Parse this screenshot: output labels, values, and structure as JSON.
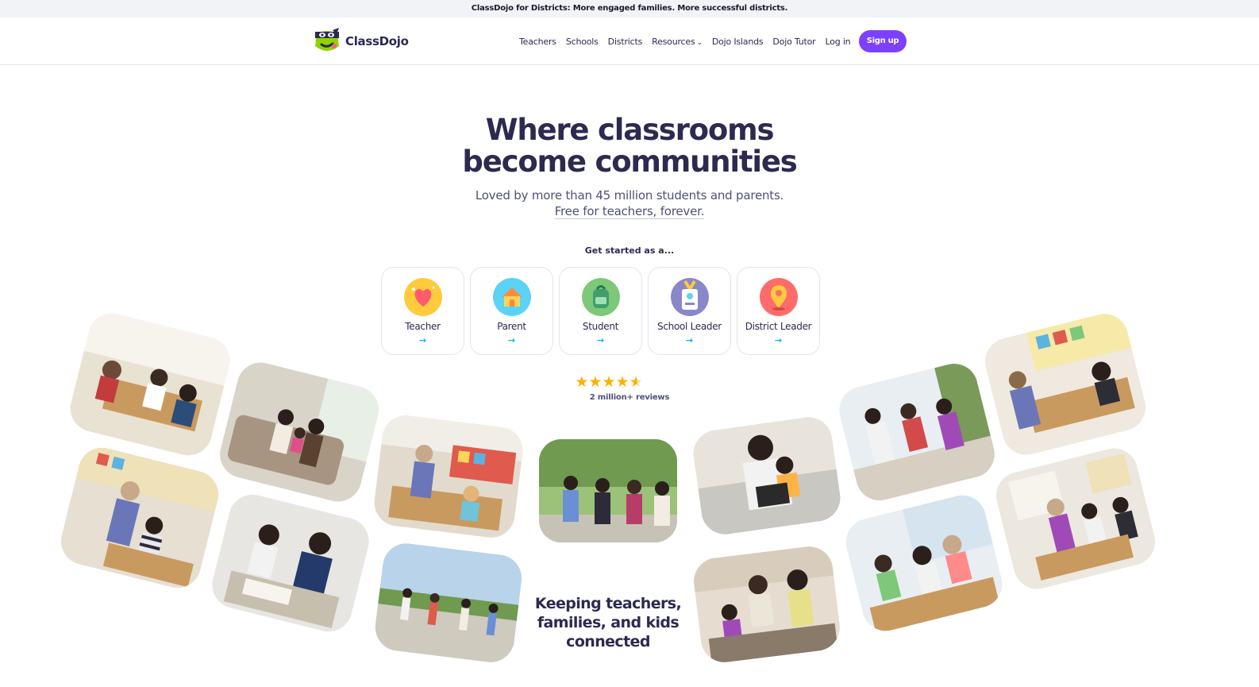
{
  "banner": {
    "text": "ClassDojo for Districts: More engaged families. More successful districts."
  },
  "brand": {
    "name": "ClassDojo",
    "logo_icon": "dojo-monster-icon",
    "colors": {
      "accent": "#7d40ff",
      "text": "#2c2a50",
      "link_arrow": "#00b2f7",
      "star": "#ffb000"
    }
  },
  "nav": {
    "items": [
      {
        "label": "Teachers"
      },
      {
        "label": "Schools"
      },
      {
        "label": "Districts"
      },
      {
        "label": "Resources",
        "icon": "chevron-down-icon"
      },
      {
        "label": "Dojo Islands"
      },
      {
        "label": "Dojo Tutor"
      }
    ],
    "login": "Log in",
    "signup": "Sign up"
  },
  "hero": {
    "title_line1": "Where classrooms",
    "title_line2": "become communities",
    "subtitle_line1": "Loved by more than 45 million students and parents.",
    "subtitle_line2": "Free for teachers, forever."
  },
  "get_started": {
    "heading": "Get started as a...",
    "roles": [
      {
        "label": "Teacher",
        "icon": "heart-icon",
        "arrow": "→"
      },
      {
        "label": "Parent",
        "icon": "house-icon",
        "arrow": "→"
      },
      {
        "label": "Student",
        "icon": "backpack-icon",
        "arrow": "→"
      },
      {
        "label": "School Leader",
        "icon": "id-badge-icon",
        "arrow": "→"
      },
      {
        "label": "District Leader",
        "icon": "map-pin-icon",
        "arrow": "→"
      }
    ]
  },
  "rating": {
    "stars": 4.5,
    "max_stars": 5,
    "reviews": "2 million+ reviews"
  },
  "photos": [
    {
      "name": "classroom-photo-group-table"
    },
    {
      "name": "family-photo-couch"
    },
    {
      "name": "classroom-photo-teacher-helping"
    },
    {
      "name": "students-photo-walking-school"
    },
    {
      "name": "parent-photo-tablet"
    },
    {
      "name": "classroom-photo-kids-playing"
    },
    {
      "name": "classroom-photo-art-table"
    },
    {
      "name": "classroom-photo-teacher-student"
    },
    {
      "name": "students-photo-reading"
    },
    {
      "name": "students-photo-field"
    },
    {
      "name": "family-photo-kitchen"
    },
    {
      "name": "classroom-photo-kids-laughing"
    },
    {
      "name": "classroom-photo-teacher-board"
    }
  ],
  "tagline": {
    "line1": "Keeping teachers,",
    "line2": "families, and kids",
    "line3": "connected"
  }
}
